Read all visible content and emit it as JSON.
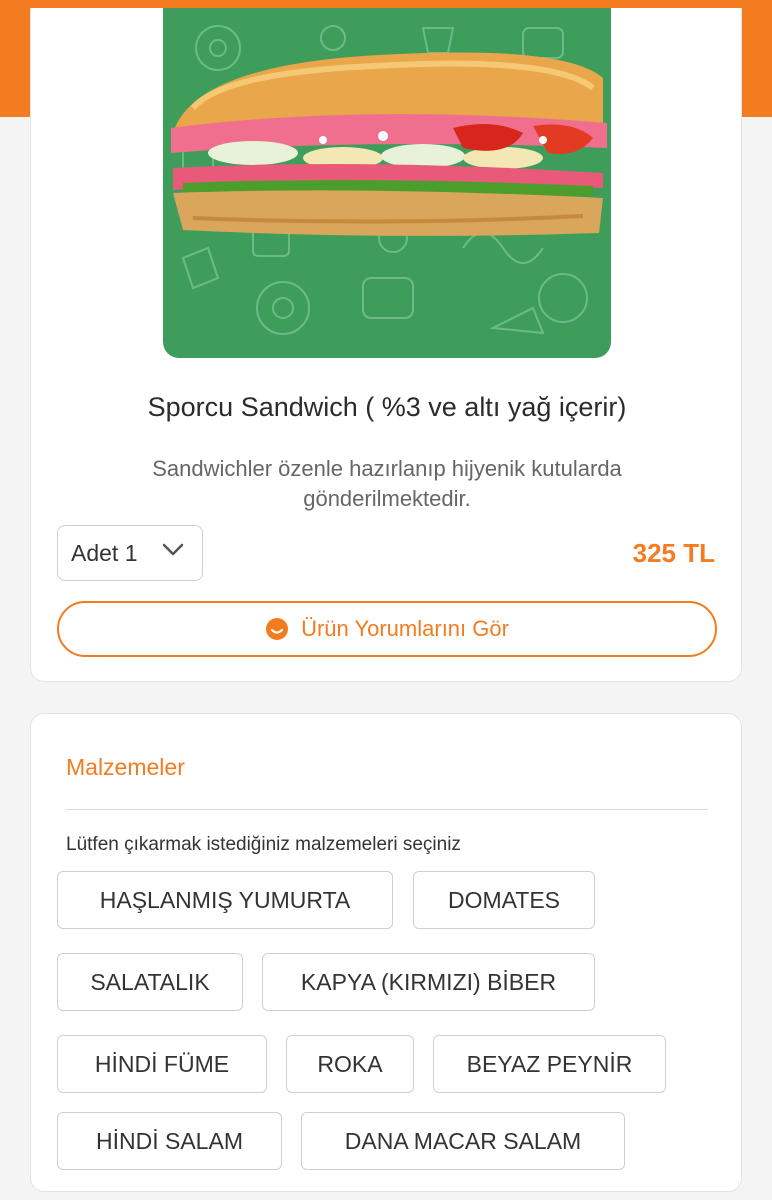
{
  "product": {
    "title": "Sporcu Sandwich ( %3 ve altı yağ içerir)",
    "description": "Sandwichler özenle hazırlanıp hijyenik kutularda gönderilmektedir.",
    "quantity_label": "Adet 1",
    "price": "325 TL",
    "reviews_button": "Ürün Yorumlarını Gör",
    "image_icon": "sandwich-image"
  },
  "ingredients": {
    "title": "Malzemeler",
    "hint": "Lütfen çıkarmak istediğiniz malzemeleri seçiniz",
    "items": [
      "HAŞLANMIŞ YUMURTA",
      "DOMATES",
      "SALATALIK",
      "KAPYA (KIRMIZI) BİBER",
      "HİNDİ FÜME",
      "ROKA",
      "BEYAZ PEYNİR",
      "HİNDİ SALAM",
      "DANA MACAR SALAM"
    ]
  },
  "colors": {
    "accent": "#f47c20",
    "image_background": "#3f9d5c"
  }
}
